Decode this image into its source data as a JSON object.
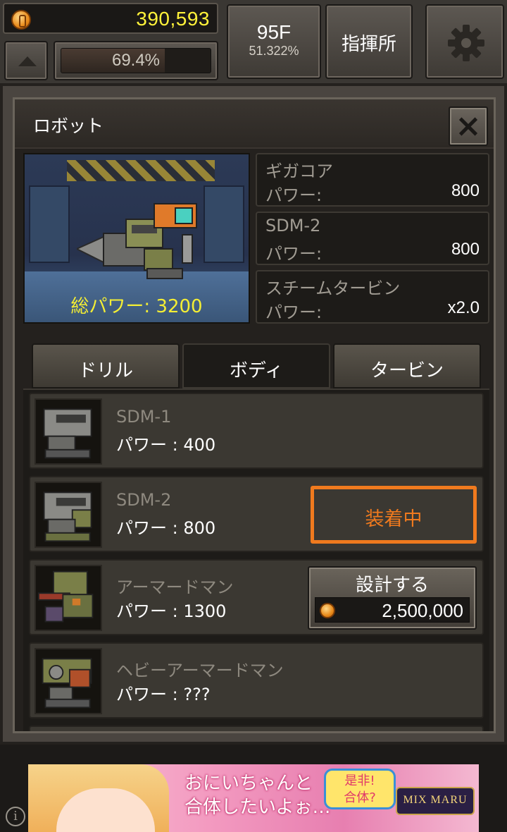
{
  "hud": {
    "coins": "390,593",
    "progress_text": "69.4%",
    "progress_fraction": 0.694,
    "floor": "95F",
    "floor_percent": "51.322%",
    "hq_label": "指揮所"
  },
  "window": {
    "title": "ロボット",
    "total_power": "総パワー: 3200"
  },
  "parts": [
    {
      "name": "ギガコア",
      "power_label": "パワー:",
      "power": "800"
    },
    {
      "name": "SDM-2",
      "power_label": "パワー:",
      "power": "800"
    },
    {
      "name": "スチームタービン",
      "power_label": "パワー:",
      "power": "x2.0"
    }
  ],
  "tabs": [
    {
      "label": "ドリル"
    },
    {
      "label": "ボディ"
    },
    {
      "label": "タービン"
    }
  ],
  "items": [
    {
      "name": "SDM-1",
      "power": "パワー : 400"
    },
    {
      "name": "SDM-2",
      "power": "パワー : 800",
      "status": "装着中"
    },
    {
      "name": "アーマードマン",
      "power": "パワー : 1300",
      "action": "設計する",
      "price": "2,500,000"
    },
    {
      "name": "ヘビーアーマードマン",
      "power": "パワー : ???"
    }
  ],
  "ad": {
    "line1": "おにいちゃんと",
    "line2": "合体したいよぉ…",
    "badge_line1": "是非!",
    "badge_line2": "合体?",
    "logo": "MIX MARU"
  },
  "colors": {
    "coin_text": "#fff23a",
    "equipped_accent": "#f07a1e",
    "total_power_text": "#f4ee34"
  }
}
